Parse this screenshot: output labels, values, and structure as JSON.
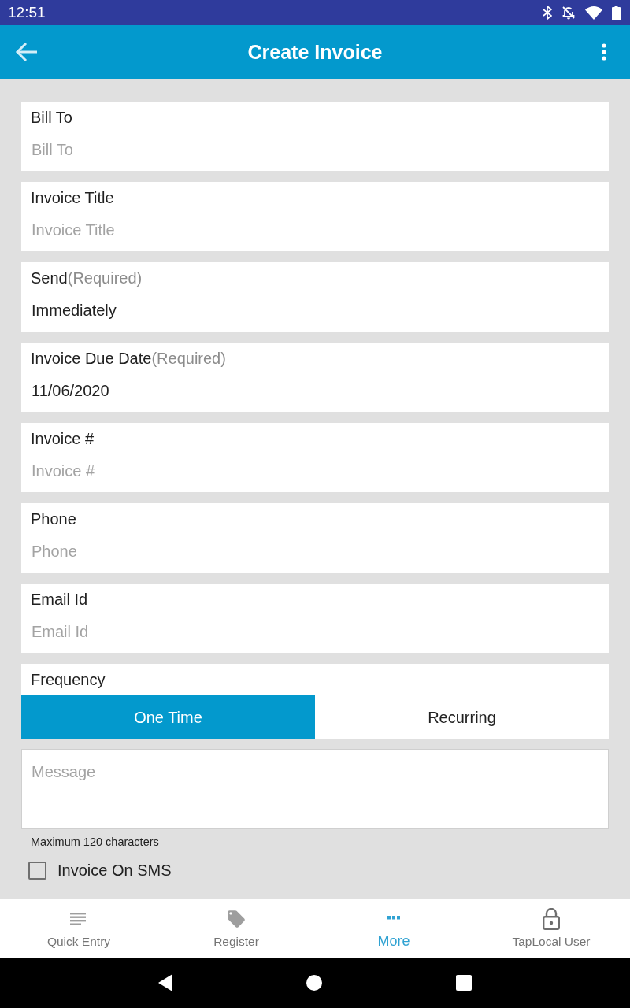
{
  "status_bar": {
    "time": "12:51"
  },
  "app_bar": {
    "title": "Create Invoice"
  },
  "fields": [
    {
      "label": "Bill To",
      "placeholder": "Bill To"
    },
    {
      "label": "Invoice Title",
      "placeholder": "Invoice Title"
    },
    {
      "label": "Send",
      "note": "(Required)",
      "value": "Immediately"
    },
    {
      "label": "Invoice Due Date",
      "note": "(Required)",
      "value": "11/06/2020"
    },
    {
      "label": "Invoice #",
      "placeholder": "Invoice #"
    },
    {
      "label": "Phone",
      "placeholder": "Phone"
    },
    {
      "label": "Email Id",
      "placeholder": "Email Id"
    }
  ],
  "frequency": {
    "label": "Frequency",
    "options": [
      {
        "label": "One Time",
        "selected": true
      },
      {
        "label": "Recurring",
        "selected": false
      }
    ]
  },
  "message": {
    "placeholder": "Message",
    "hint": "Maximum 120 characters"
  },
  "sms_option": {
    "label": "Invoice On SMS",
    "checked": false
  },
  "bottom_nav": [
    {
      "label": "Quick Entry",
      "selected": false
    },
    {
      "label": "Register",
      "selected": false
    },
    {
      "label": "More",
      "selected": true
    },
    {
      "label": "TapLocal User",
      "selected": false
    }
  ]
}
